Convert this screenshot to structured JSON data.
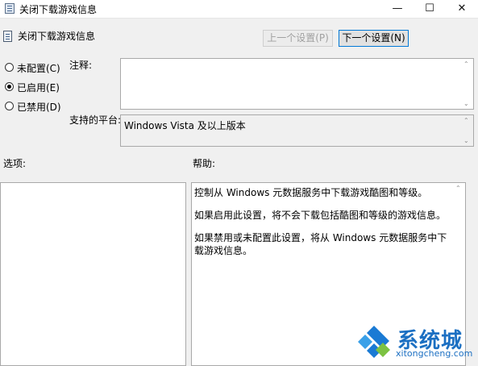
{
  "window": {
    "title": "关闭下载游戏信息",
    "minimize_glyph": "—",
    "maximize_glyph": "☐",
    "close_glyph": "✕"
  },
  "header": {
    "policy_title": "关闭下载游戏信息",
    "prev_button": "上一个设置(P)",
    "next_button": "下一个设置(N)"
  },
  "state": {
    "options": [
      {
        "label": "未配置(C)",
        "selected": false
      },
      {
        "label": "已启用(E)",
        "selected": true
      },
      {
        "label": "已禁用(D)",
        "selected": false
      }
    ]
  },
  "comment": {
    "label": "注释:",
    "value": ""
  },
  "platform": {
    "label": "支持的平台:",
    "value": "Windows Vista 及以上版本"
  },
  "options_section": {
    "label": "选项:"
  },
  "help_section": {
    "label": "帮助:",
    "paragraphs": [
      "控制从 Windows 元数据服务中下载游戏酷图和等级。",
      "如果启用此设置，将不会下载包括酷图和等级的游戏信息。",
      "如果禁用或未配置此设置，将从 Windows 元数据服务中下载游戏信息。"
    ]
  },
  "watermark": {
    "brand": "系统城",
    "url": "xitongcheng.com"
  },
  "icons": [
    "policy-icon",
    "minimize-icon",
    "maximize-icon",
    "close-icon",
    "scroll-up-arrow-icon",
    "scroll-down-arrow-icon"
  ]
}
